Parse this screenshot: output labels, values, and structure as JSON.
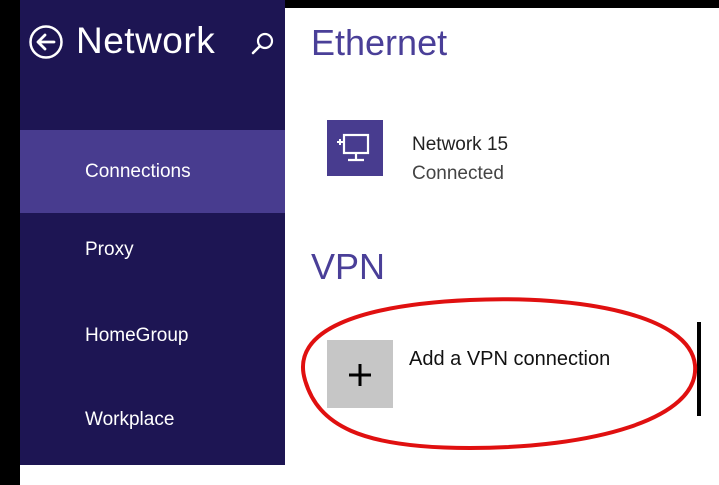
{
  "sidebar": {
    "title": "Network",
    "items": [
      {
        "label": "Connections",
        "selected": true
      },
      {
        "label": "Proxy",
        "selected": false
      },
      {
        "label": "HomeGroup",
        "selected": false
      },
      {
        "label": "Workplace",
        "selected": false
      }
    ]
  },
  "ethernet": {
    "section_title": "Ethernet",
    "network_name": "Network 15",
    "status": "Connected"
  },
  "vpn": {
    "section_title": "VPN",
    "add_label": "Add a VPN connection"
  },
  "colors": {
    "sidebar_bg": "#1d1553",
    "selected_bg": "#483c8f",
    "accent": "#4a3f98",
    "annotation": "#e01010"
  }
}
